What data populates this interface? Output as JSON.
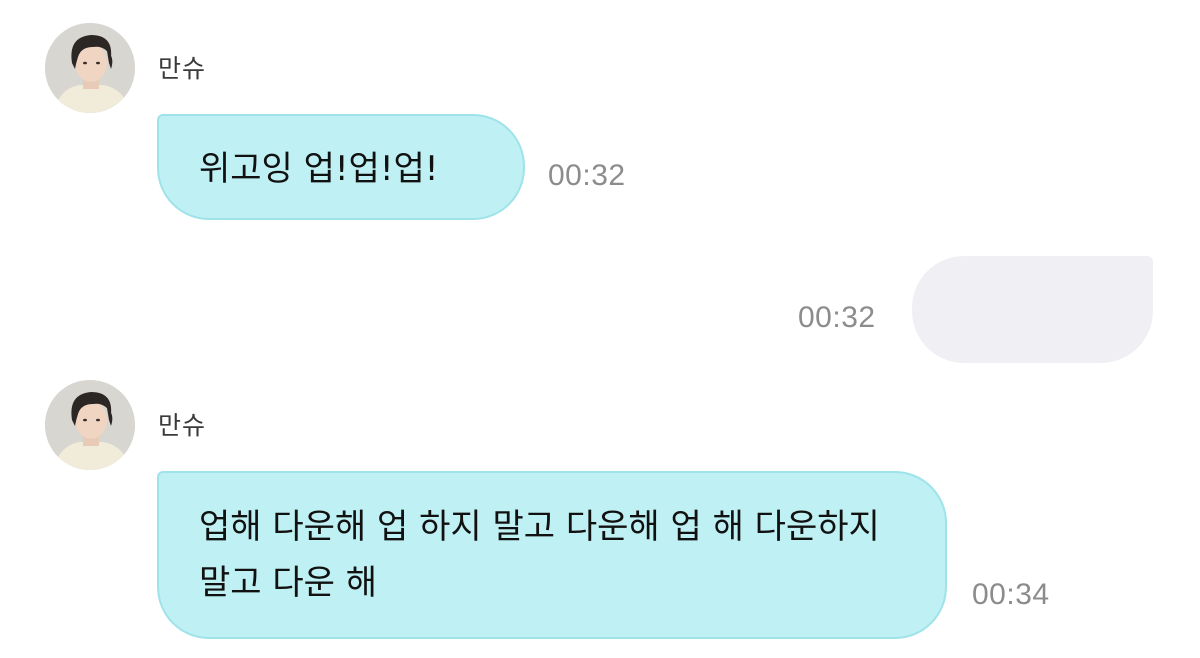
{
  "conversation": {
    "messages": [
      {
        "direction": "incoming",
        "sender": "만슈",
        "text": "위고잉 업!업!업!",
        "time": "00:32"
      },
      {
        "direction": "outgoing",
        "text": "",
        "time": "00:32"
      },
      {
        "direction": "incoming",
        "sender": "만슈",
        "text": "업해 다운해 업 하지 말고 다운해 업 해 다운하지 말고 다운 해",
        "time": "00:34"
      }
    ]
  },
  "colors": {
    "incoming_bubble": "#bff0f3",
    "incoming_bubble_border": "#9fe3ea",
    "outgoing_bubble": "#f0f0f4",
    "timestamp": "#8c8c8c"
  },
  "icons": {
    "avatar": "profile-photo"
  }
}
